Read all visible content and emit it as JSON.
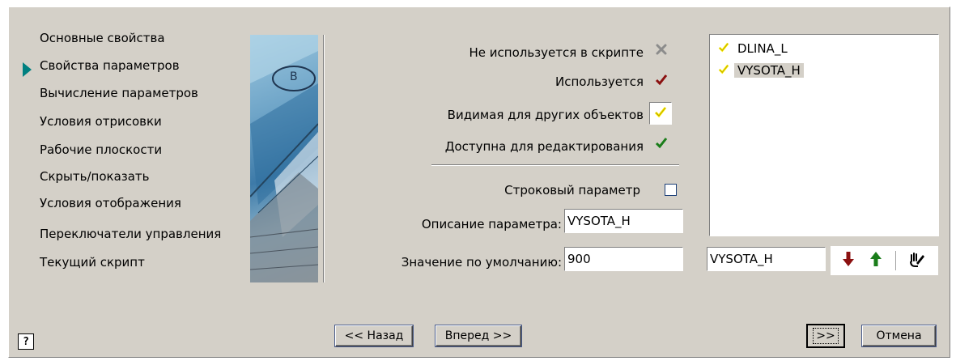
{
  "nav": {
    "items": [
      {
        "label": "Основные свойства"
      },
      {
        "label": "Свойства параметров"
      },
      {
        "label": "Вычисление параметров"
      },
      {
        "label": "Условия отрисовки"
      },
      {
        "label": "Рабочие плоскости"
      },
      {
        "label": "Скрыть/показать"
      },
      {
        "label": "Условия отображения"
      },
      {
        "label": "Переключатели управления"
      },
      {
        "label": "Текущий скрипт"
      }
    ],
    "active_index": 1
  },
  "image_panel": {
    "badge_text": "B"
  },
  "param_state": {
    "not_used_label": "Не используется в скрипте",
    "used_label": "Используется",
    "visible_label": "Видимая для других объектов",
    "editable_label": "Доступна для редактирования",
    "icons": {
      "not_used": "gray-x-icon",
      "used": "red-check-icon",
      "visible": "yellow-check-icon",
      "editable": "green-check-icon"
    },
    "colors": {
      "used": "#8b1010",
      "visible": "#ffee00",
      "editable": "#1a7d1a",
      "not_used": "#8c8c8c"
    },
    "selected_state": "visible"
  },
  "string_param": {
    "label": "Строковый параметр",
    "checked": false
  },
  "description": {
    "label": "Описание параметра:",
    "value": "VYSOTA_H"
  },
  "default_value": {
    "label": "Значение по умолчанию:",
    "value": "900"
  },
  "param_list": {
    "items": [
      {
        "name": "DLINA_L",
        "icon": "yellow-check-icon"
      },
      {
        "name": "VYSOTA_H",
        "icon": "yellow-check-icon",
        "selected": true
      }
    ]
  },
  "name_field": {
    "value": "VYSOTA_H"
  },
  "tools": {
    "move_down_icon": "red-down-arrow-icon",
    "move_up_icon": "green-up-arrow-icon",
    "edit_icon": "hand-pencil-icon"
  },
  "buttons": {
    "help": "?",
    "back": "<< Назад",
    "next": "Вперед >>",
    "finish": ">>",
    "cancel": "Отмена"
  }
}
